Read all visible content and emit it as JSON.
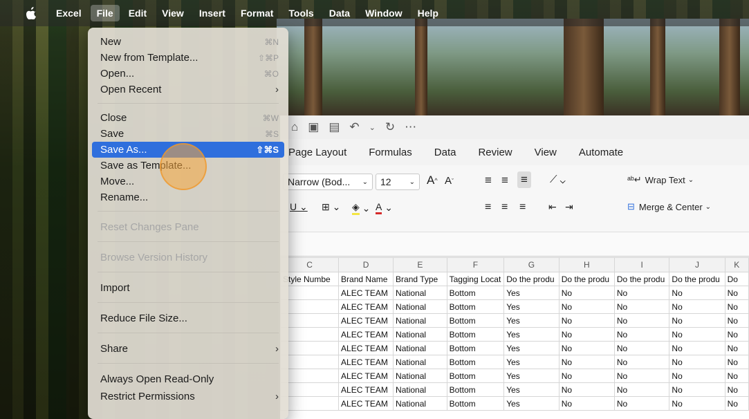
{
  "menubar": {
    "app": "Excel",
    "items": [
      "File",
      "Edit",
      "View",
      "Insert",
      "Format",
      "Tools",
      "Data",
      "Window",
      "Help"
    ]
  },
  "file_menu": {
    "items": [
      {
        "label": "New",
        "shortcut": "⌘N"
      },
      {
        "label": "New from Template...",
        "shortcut": "⇧⌘P"
      },
      {
        "label": "Open...",
        "shortcut": "⌘O"
      },
      {
        "label": "Open Recent",
        "submenu": "›"
      },
      {
        "label": "Close",
        "shortcut": "⌘W"
      },
      {
        "label": "Save",
        "shortcut": "⌘S"
      },
      {
        "label": "Save As...",
        "shortcut": "⇧⌘S"
      },
      {
        "label": "Save as Template..."
      },
      {
        "label": "Move..."
      },
      {
        "label": "Rename..."
      },
      {
        "label": "Reset Changes Pane"
      },
      {
        "label": "Browse Version History"
      },
      {
        "label": "Import"
      },
      {
        "label": "Reduce File Size..."
      },
      {
        "label": "Share",
        "submenu": "›"
      },
      {
        "label": "Always Open Read-Only"
      },
      {
        "label": "Restrict Permissions",
        "submenu": "›"
      }
    ]
  },
  "ribbon": {
    "tabs": [
      "Page Layout",
      "Formulas",
      "Data",
      "Review",
      "View",
      "Automate"
    ],
    "font_name": "Narrow (Bod...",
    "font_size": "12",
    "wrap_text": "Wrap Text",
    "merge_center": "Merge & Center"
  },
  "grid": {
    "columns": [
      "C",
      "D",
      "E",
      "F",
      "G",
      "H",
      "I",
      "J",
      "K"
    ],
    "header_row": [
      "Style Numbe",
      "Brand Name",
      "Brand Type",
      "Tagging Locat",
      "Do the produ",
      "Do the produ",
      "Do the produ",
      "Do the produ",
      "Do"
    ],
    "row_values": [
      "",
      "ALEC TEAM",
      "National",
      "Bottom",
      "Yes",
      "No",
      "No",
      "No",
      "No"
    ],
    "row_count": 9
  }
}
